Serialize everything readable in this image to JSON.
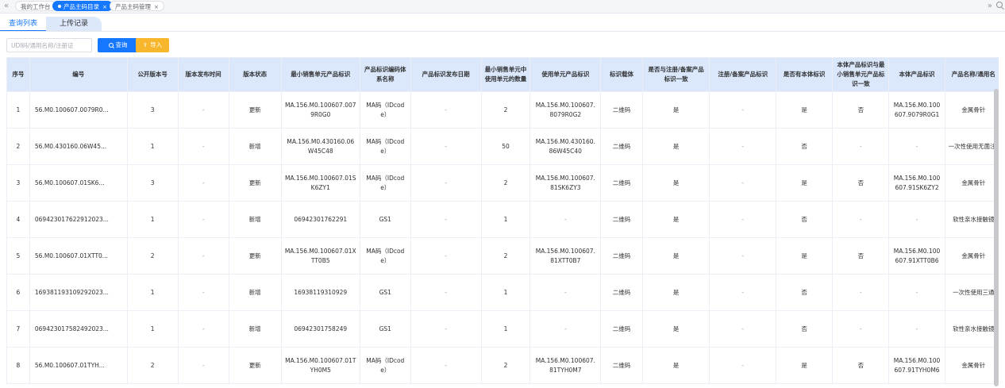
{
  "tabs": [
    {
      "label": "我的工作台",
      "active": false,
      "closable": false
    },
    {
      "label": "产品主码目录",
      "active": true,
      "closable": true
    },
    {
      "label": "产品主码管理",
      "active": false,
      "closable": true
    }
  ],
  "nav": {
    "prev": "«",
    "next": "»"
  },
  "subtabs": {
    "query": "查询列表",
    "upload": "上传记录"
  },
  "filter": {
    "placeholder": "UDI码/通用名称/注册证",
    "query_label": "查询",
    "import_label": "导入"
  },
  "colors": {
    "accent": "#1677ff",
    "header_bg": "#dbe8fb",
    "import_btn": "#f8b62d",
    "subtab_inactive": "#dde9fb"
  },
  "table": {
    "columns": [
      "序号",
      "编号",
      "公开版本号",
      "版本发布时间",
      "版本状态",
      "最小销售单元产品标识",
      "产品标识编码体系名称",
      "产品标识发布日期",
      "最小销售单元中使用单元的数量",
      "使用单元产品标识",
      "标识载体",
      "是否与注册/备案产品标识一致",
      "注册/备案产品标识",
      "是否有本体标识",
      "本体产品标识与最小销售单元产品标识一致",
      "本体产品标识",
      "产品名称/通用名"
    ],
    "rows": [
      [
        "1",
        "56.M0.100607.0079R0...",
        "3",
        "-",
        "更新",
        "MA.156.M0.100607.0079R0G0",
        "MA码（IDcode）",
        "-",
        "2",
        "MA.156.M0.100607.8079R0G2",
        "二维码",
        "是",
        "-",
        "是",
        "否",
        "MA.156.M0.100607.9079R0G1",
        "金属骨针"
      ],
      [
        "2",
        "56.M0.430160.06W45...",
        "1",
        "-",
        "新增",
        "MA.156.M0.430160.06W45C48",
        "MA码（IDcode）",
        "-",
        "50",
        "MA.156.M0.430160.86W45C40",
        "二维码",
        "是",
        "-",
        "否",
        "-",
        "-",
        "一次性使用无菌注射"
      ],
      [
        "3",
        "56.M0.100607.01SK6...",
        "3",
        "-",
        "更新",
        "MA.156.M0.100607.01SK6ZY1",
        "MA码（IDcode）",
        "-",
        "2",
        "MA.156.M0.100607.81SK6ZY3",
        "二维码",
        "是",
        "-",
        "是",
        "否",
        "MA.156.M0.100607.91SK6ZY2",
        "金属骨针"
      ],
      [
        "4",
        "069423017622912023...",
        "1",
        "-",
        "新增",
        "06942301762291",
        "GS1",
        "-",
        "1",
        "-",
        "二维码",
        "是",
        "-",
        "否",
        "-",
        "-",
        "软性亲水接触镜"
      ],
      [
        "5",
        "56.M0.100607.01XTT0...",
        "2",
        "-",
        "更新",
        "MA.156.M0.100607.01XTT0B5",
        "MA码（IDcode）",
        "-",
        "2",
        "MA.156.M0.100607.81XTT0B7",
        "二维码",
        "是",
        "-",
        "是",
        "否",
        "MA.156.M0.100607.91XTT0B6",
        "金属骨针"
      ],
      [
        "6",
        "169381193109292023...",
        "1",
        "-",
        "新增",
        "16938119310929",
        "GS1",
        "-",
        "1",
        "-",
        "二维码",
        "是",
        "-",
        "否",
        "-",
        "-",
        "一次性使用三通"
      ],
      [
        "7",
        "069423017582492023...",
        "1",
        "-",
        "新增",
        "06942301758249",
        "GS1",
        "-",
        "1",
        "-",
        "二维码",
        "是",
        "-",
        "否",
        "-",
        "-",
        "软性亲水接触镜"
      ],
      [
        "8",
        "56.M0.100607.01TYH...",
        "2",
        "-",
        "更新",
        "MA.156.M0.100607.01TYH0M5",
        "MA码（IDcode）",
        "-",
        "2",
        "MA.156.M0.100607.81TYH0M7",
        "二维码",
        "是",
        "-",
        "是",
        "否",
        "MA.156.M0.100607.91TYH0M6",
        "金属骨针"
      ]
    ]
  }
}
